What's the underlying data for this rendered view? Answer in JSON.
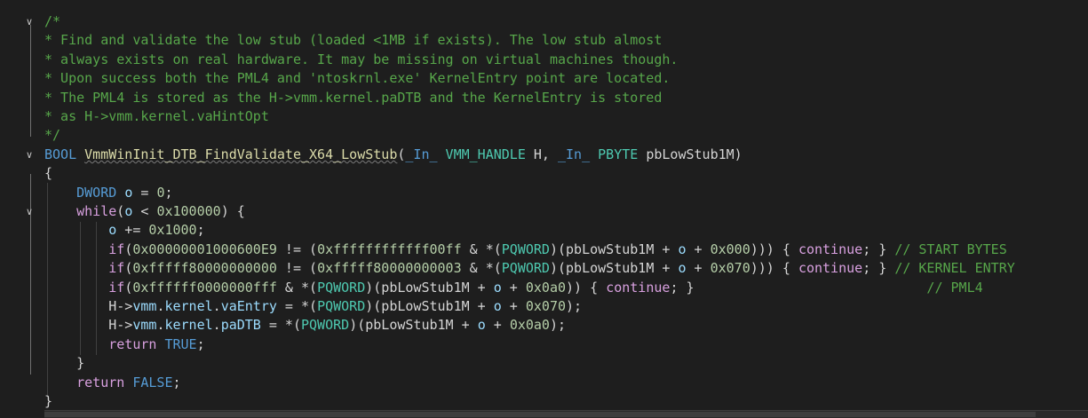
{
  "editor": {
    "language": "C",
    "colors": {
      "background": "#1e1e1e",
      "comment": "#57a64a",
      "keyword": "#569cd6",
      "type": "#4ec9b0",
      "number": "#b5cea8",
      "function": "#dcdcaa",
      "variable": "#9cdcfe",
      "control": "#d8a0df",
      "text": "#d4d4d4"
    },
    "fold_icons": {
      "expanded": "chevron-down-icon"
    },
    "horizontal_scroll_fraction": 0.95,
    "lines": [
      {
        "fold": "chevron-down-icon",
        "tokens": [
          [
            "/*",
            "cm"
          ]
        ]
      },
      {
        "tokens": [
          [
            "* Find and validate the low stub (loaded <1MB if exists). The low stub almost",
            "cm"
          ]
        ]
      },
      {
        "tokens": [
          [
            "* always exists on real hardware. It may be missing on virtual machines though.",
            "cm"
          ]
        ]
      },
      {
        "tokens": [
          [
            "* Upon success both the PML4 and 'ntoskrnl.exe' KernelEntry point are located.",
            "cm"
          ]
        ]
      },
      {
        "tokens": [
          [
            "* The PML4 is stored as the H->vmm.kernel.paDTB and the KernelEntry is stored",
            "cm"
          ]
        ]
      },
      {
        "tokens": [
          [
            "* as H->vmm.kernel.vaHintOpt",
            "cm"
          ]
        ]
      },
      {
        "tokens": [
          [
            "*/",
            "cm"
          ]
        ]
      },
      {
        "fold": "chevron-down-icon",
        "tokens": [
          [
            "BOOL",
            "kw"
          ],
          [
            " ",
            "plain"
          ],
          [
            "VmmWinInit_DTB_FindValidate_X64_LowStub",
            "fn squig"
          ],
          [
            "(",
            "plain"
          ],
          [
            "_In_",
            "kw"
          ],
          [
            " ",
            "plain"
          ],
          [
            "VMM_HANDLE",
            "ty"
          ],
          [
            " H, ",
            "plain"
          ],
          [
            "_In_",
            "kw"
          ],
          [
            " ",
            "plain"
          ],
          [
            "PBYTE",
            "ty"
          ],
          [
            " pbLowStub1M)",
            "plain"
          ]
        ]
      },
      {
        "tokens": [
          [
            "{",
            "plain"
          ]
        ]
      },
      {
        "tokens": [
          [
            "    ",
            "plain"
          ],
          [
            "DWORD",
            "kw"
          ],
          [
            " ",
            "plain"
          ],
          [
            "o",
            "var"
          ],
          [
            " = ",
            "plain"
          ],
          [
            "0",
            "num"
          ],
          [
            ";",
            "plain"
          ]
        ]
      },
      {
        "fold": "chevron-down-icon",
        "tokens": [
          [
            "    ",
            "plain"
          ],
          [
            "while",
            "ctl"
          ],
          [
            "(",
            "plain"
          ],
          [
            "o",
            "var"
          ],
          [
            " < ",
            "plain"
          ],
          [
            "0x100000",
            "num"
          ],
          [
            ") {",
            "plain"
          ]
        ]
      },
      {
        "tokens": [
          [
            "        ",
            "plain"
          ],
          [
            "o",
            "var"
          ],
          [
            " += ",
            "plain"
          ],
          [
            "0x1000",
            "num"
          ],
          [
            ";",
            "plain"
          ]
        ]
      },
      {
        "tokens": [
          [
            "        ",
            "plain"
          ],
          [
            "if",
            "ctl"
          ],
          [
            "(",
            "plain"
          ],
          [
            "0x00000001000600E9",
            "num"
          ],
          [
            " != (",
            "plain"
          ],
          [
            "0xffffffffffff00ff",
            "num"
          ],
          [
            " & *(",
            "plain"
          ],
          [
            "PQWORD",
            "ty"
          ],
          [
            ")(pbLowStub1M + ",
            "plain"
          ],
          [
            "o",
            "var"
          ],
          [
            " + ",
            "plain"
          ],
          [
            "0x000",
            "num"
          ],
          [
            "))) { ",
            "plain"
          ],
          [
            "continue",
            "ctl"
          ],
          [
            "; } ",
            "plain"
          ],
          [
            "// START BYTES",
            "cm"
          ]
        ]
      },
      {
        "tokens": [
          [
            "        ",
            "plain"
          ],
          [
            "if",
            "ctl"
          ],
          [
            "(",
            "plain"
          ],
          [
            "0xfffff80000000000",
            "num"
          ],
          [
            " != (",
            "plain"
          ],
          [
            "0xfffff80000000003",
            "num"
          ],
          [
            " & *(",
            "plain"
          ],
          [
            "PQWORD",
            "ty"
          ],
          [
            ")(pbLowStub1M + ",
            "plain"
          ],
          [
            "o",
            "var"
          ],
          [
            " + ",
            "plain"
          ],
          [
            "0x070",
            "num"
          ],
          [
            "))) { ",
            "plain"
          ],
          [
            "continue",
            "ctl"
          ],
          [
            "; } ",
            "plain"
          ],
          [
            "// KERNEL ENTRY",
            "cm"
          ]
        ]
      },
      {
        "tokens": [
          [
            "        ",
            "plain"
          ],
          [
            "if",
            "ctl"
          ],
          [
            "(",
            "plain"
          ],
          [
            "0xffffff0000000fff",
            "num"
          ],
          [
            " & *(",
            "plain"
          ],
          [
            "PQWORD",
            "ty"
          ],
          [
            ")(pbLowStub1M + ",
            "plain"
          ],
          [
            "o",
            "var"
          ],
          [
            " + ",
            "plain"
          ],
          [
            "0x0a0",
            "num"
          ],
          [
            ")) { ",
            "plain"
          ],
          [
            "continue",
            "ctl"
          ],
          [
            "; }                             ",
            "plain"
          ],
          [
            "// PML4",
            "cm"
          ]
        ]
      },
      {
        "tokens": [
          [
            "        H->",
            "plain"
          ],
          [
            "vmm",
            "var"
          ],
          [
            ".",
            "plain"
          ],
          [
            "kernel",
            "var"
          ],
          [
            ".",
            "plain"
          ],
          [
            "vaEntry",
            "var"
          ],
          [
            " = *(",
            "plain"
          ],
          [
            "PQWORD",
            "ty"
          ],
          [
            ")(pbLowStub1M + ",
            "plain"
          ],
          [
            "o",
            "var"
          ],
          [
            " + ",
            "plain"
          ],
          [
            "0x070",
            "num"
          ],
          [
            ");",
            "plain"
          ]
        ]
      },
      {
        "tokens": [
          [
            "        H->",
            "plain"
          ],
          [
            "vmm",
            "var"
          ],
          [
            ".",
            "plain"
          ],
          [
            "kernel",
            "var"
          ],
          [
            ".",
            "plain"
          ],
          [
            "paDTB",
            "var"
          ],
          [
            " = *(",
            "plain"
          ],
          [
            "PQWORD",
            "ty"
          ],
          [
            ")(pbLowStub1M + ",
            "plain"
          ],
          [
            "o",
            "var"
          ],
          [
            " + ",
            "plain"
          ],
          [
            "0x0a0",
            "num"
          ],
          [
            ");",
            "plain"
          ]
        ]
      },
      {
        "tokens": [
          [
            "        ",
            "plain"
          ],
          [
            "return",
            "ctl"
          ],
          [
            " ",
            "plain"
          ],
          [
            "TRUE",
            "kw"
          ],
          [
            ";",
            "plain"
          ]
        ]
      },
      {
        "tokens": [
          [
            "    }",
            "plain"
          ]
        ]
      },
      {
        "tokens": [
          [
            "    ",
            "plain"
          ],
          [
            "return",
            "ctl"
          ],
          [
            " ",
            "plain"
          ],
          [
            "FALSE",
            "kw"
          ],
          [
            ";",
            "plain"
          ]
        ]
      },
      {
        "tokens": [
          [
            "}",
            "plain"
          ]
        ]
      }
    ]
  }
}
